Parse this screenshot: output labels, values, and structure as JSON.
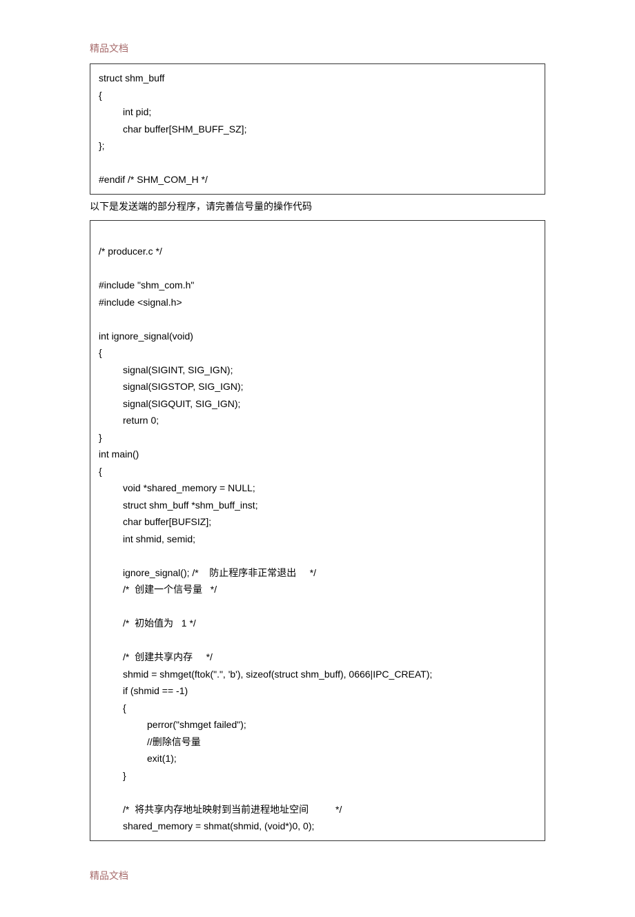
{
  "header": "精品文档",
  "footer": "精品文档",
  "box1": {
    "lines": [
      {
        "cls": "",
        "text": "struct shm_buff"
      },
      {
        "cls": "",
        "text": "{"
      },
      {
        "cls": "indent1",
        "text": "int pid;"
      },
      {
        "cls": "indent1",
        "text": "char buffer[SHM_BUFF_SZ];"
      },
      {
        "cls": "",
        "text": "};"
      },
      {
        "cls": "gap",
        "text": ""
      },
      {
        "cls": "",
        "text": "#endif /* SHM_COM_H */"
      }
    ]
  },
  "interline": "以下是发送端的部分程序，请完善信号量的操作代码",
  "box2": {
    "lines": [
      {
        "cls": "gap",
        "text": ""
      },
      {
        "cls": "",
        "text": "/* producer.c */"
      },
      {
        "cls": "gap",
        "text": ""
      },
      {
        "cls": "",
        "text": "#include \"shm_com.h\""
      },
      {
        "cls": "",
        "text": "#include <signal.h>"
      },
      {
        "cls": "gap",
        "text": ""
      },
      {
        "cls": "",
        "text": "int ignore_signal(void)"
      },
      {
        "cls": "",
        "text": "{"
      },
      {
        "cls": "indent1",
        "text": "signal(SIGINT, SIG_IGN);"
      },
      {
        "cls": "indent1",
        "text": "signal(SIGSTOP, SIG_IGN);"
      },
      {
        "cls": "indent1",
        "text": "signal(SIGQUIT, SIG_IGN);"
      },
      {
        "cls": "indent1",
        "text": "return 0;"
      },
      {
        "cls": "",
        "text": "}"
      },
      {
        "cls": "",
        "text": "int main()"
      },
      {
        "cls": "",
        "text": "{"
      },
      {
        "cls": "indent1",
        "text": "void *shared_memory = NULL;"
      },
      {
        "cls": "indent1",
        "text": "struct shm_buff *shm_buff_inst;"
      },
      {
        "cls": "indent1",
        "text": "char buffer[BUFSIZ];"
      },
      {
        "cls": "indent1",
        "text": "int shmid, semid;"
      },
      {
        "cls": "gap",
        "text": ""
      },
      {
        "cls": "indent1",
        "text": "ignore_signal(); /*    防止程序非正常退出     */",
        "cjk": true
      },
      {
        "cls": "indent1",
        "text": "/*  创建一个信号量   */",
        "cjk": true
      },
      {
        "cls": "gap",
        "text": ""
      },
      {
        "cls": "indent1",
        "text": "/*  初始值为   1 */",
        "cjk": true
      },
      {
        "cls": "gap",
        "text": ""
      },
      {
        "cls": "indent1",
        "text": "/*  创建共享内存     */",
        "cjk": true
      },
      {
        "cls": "indent1",
        "text": "shmid = shmget(ftok(\".\", 'b'), sizeof(struct shm_buff), 0666|IPC_CREAT);"
      },
      {
        "cls": "indent1",
        "text": "if (shmid == -1)"
      },
      {
        "cls": "indent1",
        "text": "{"
      },
      {
        "cls": "indent2",
        "text": "perror(\"shmget failed\");"
      },
      {
        "cls": "indent2",
        "text": "//删除信号量",
        "cjk": true
      },
      {
        "cls": "indent2",
        "text": "exit(1);"
      },
      {
        "cls": "indent1",
        "text": "}"
      },
      {
        "cls": "gap",
        "text": ""
      },
      {
        "cls": "indent1",
        "text": "/*  将共享内存地址映射到当前进程地址空间          */",
        "cjk": true
      },
      {
        "cls": "indent1",
        "text": "shared_memory = shmat(shmid, (void*)0, 0);"
      }
    ]
  }
}
